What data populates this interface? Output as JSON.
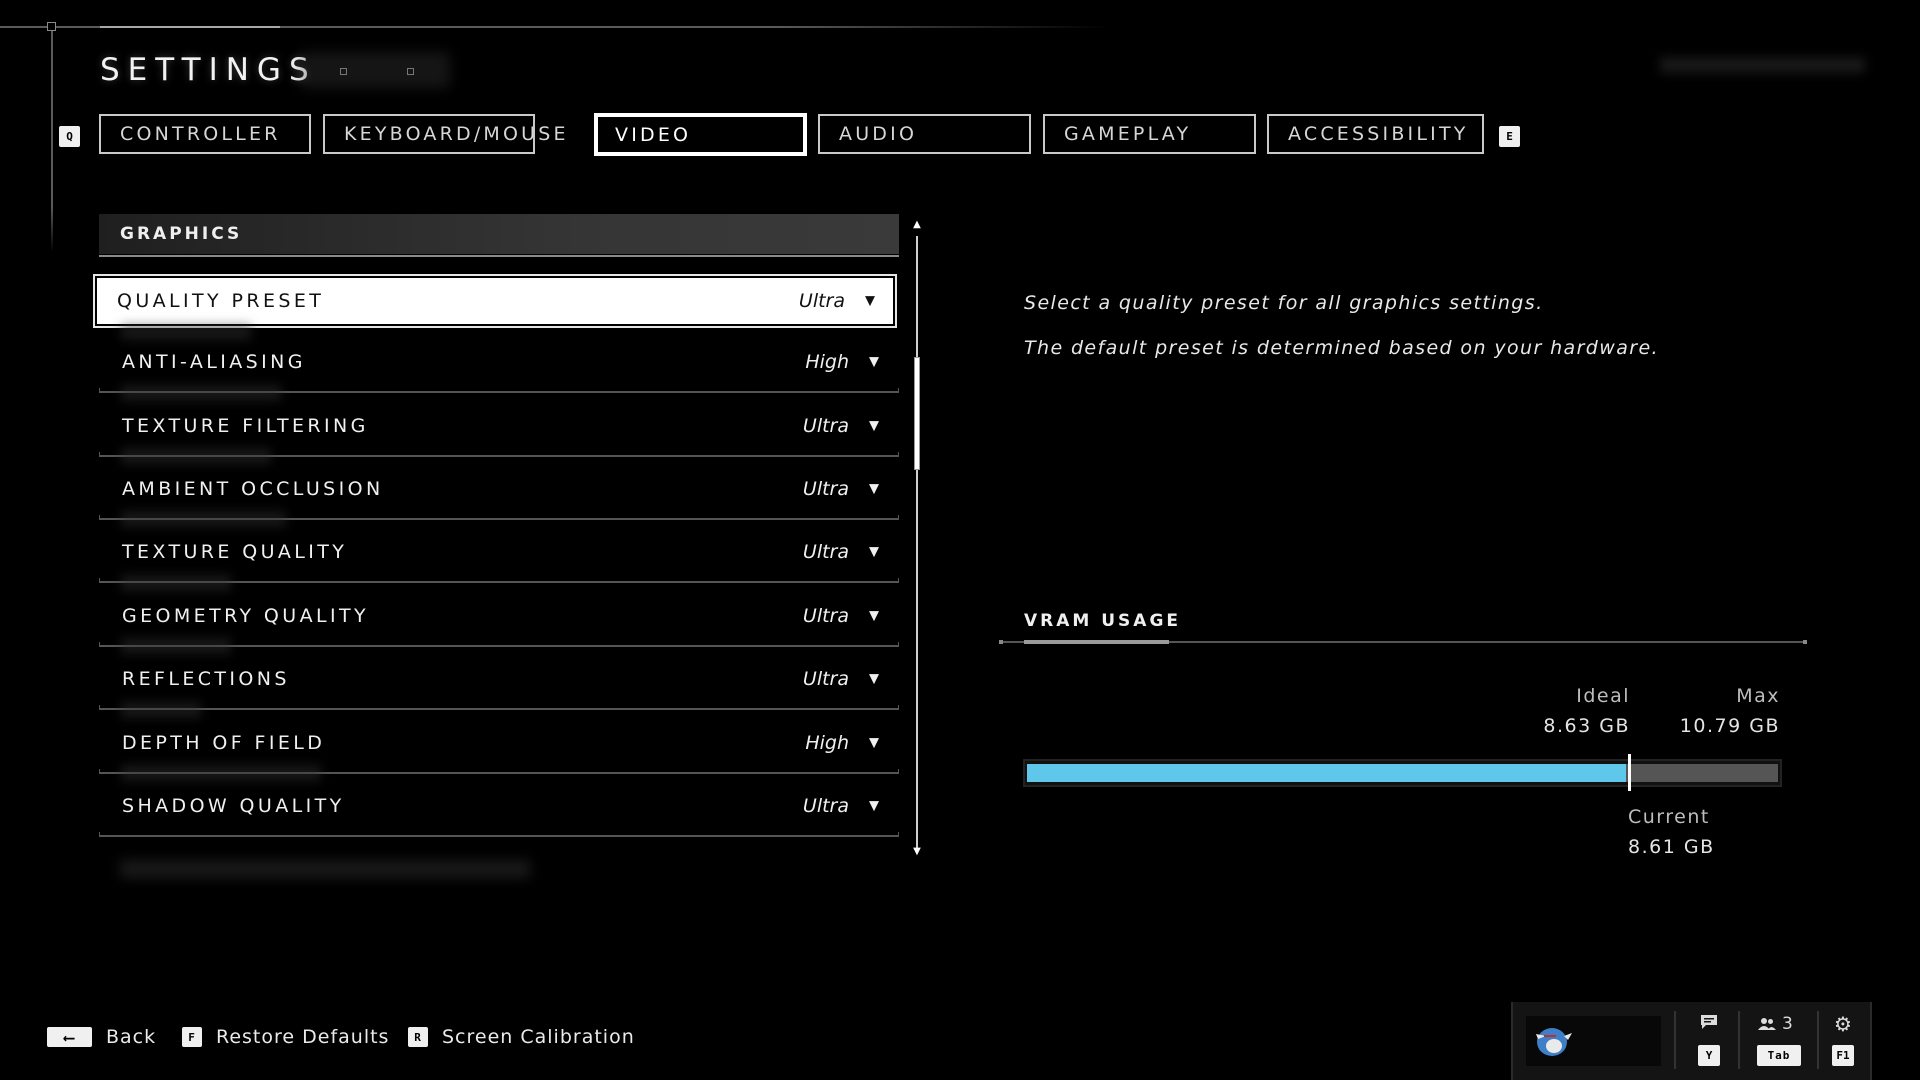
{
  "header": {
    "title": "SETTINGS"
  },
  "tabs": {
    "prev_key": "Q",
    "next_key": "E",
    "items": [
      {
        "label": "CONTROLLER",
        "active": false
      },
      {
        "label": "KEYBOARD/MOUSE",
        "active": false
      },
      {
        "label": "VIDEO",
        "active": true
      },
      {
        "label": "AUDIO",
        "active": false
      },
      {
        "label": "GAMEPLAY",
        "active": false
      },
      {
        "label": "ACCESSIBILITY",
        "active": false
      }
    ]
  },
  "graphics": {
    "section_title": "GRAPHICS",
    "rows": [
      {
        "label": "QUALITY PRESET",
        "value": "Ultra",
        "selected": true
      },
      {
        "label": "ANTI-ALIASING",
        "value": "High"
      },
      {
        "label": "TEXTURE FILTERING",
        "value": "Ultra"
      },
      {
        "label": "AMBIENT OCCLUSION",
        "value": "Ultra"
      },
      {
        "label": "TEXTURE QUALITY",
        "value": "Ultra"
      },
      {
        "label": "GEOMETRY QUALITY",
        "value": "Ultra"
      },
      {
        "label": "REFLECTIONS",
        "value": "Ultra"
      },
      {
        "label": "DEPTH OF FIELD",
        "value": "High"
      },
      {
        "label": "SHADOW QUALITY",
        "value": "Ultra"
      }
    ],
    "dropdown_icon": "▼",
    "scroll_up_icon": "▲",
    "scroll_down_icon": "▼"
  },
  "description": {
    "line1": "Select a quality preset for all graphics settings.",
    "line2": "The default preset is determined based on your hardware."
  },
  "vram": {
    "title": "VRAM USAGE",
    "ideal_label": "Ideal",
    "ideal_value": "8.63 GB",
    "max_label": "Max",
    "max_value": "10.79 GB",
    "current_label": "Current",
    "current_value": "8.61 GB",
    "current_gb": 8.61,
    "ideal_gb": 8.63,
    "max_gb": 10.79,
    "fill_color": "#5fc8ea"
  },
  "footer": {
    "back_key": "⟵",
    "back_label": "Back",
    "restore_key": "F",
    "restore_label": "Restore Defaults",
    "calibration_key": "R",
    "calibration_label": "Screen Calibration"
  },
  "social": {
    "chat_key": "Y",
    "party_count": "3",
    "party_key": "Tab",
    "settings_key": "F1"
  }
}
